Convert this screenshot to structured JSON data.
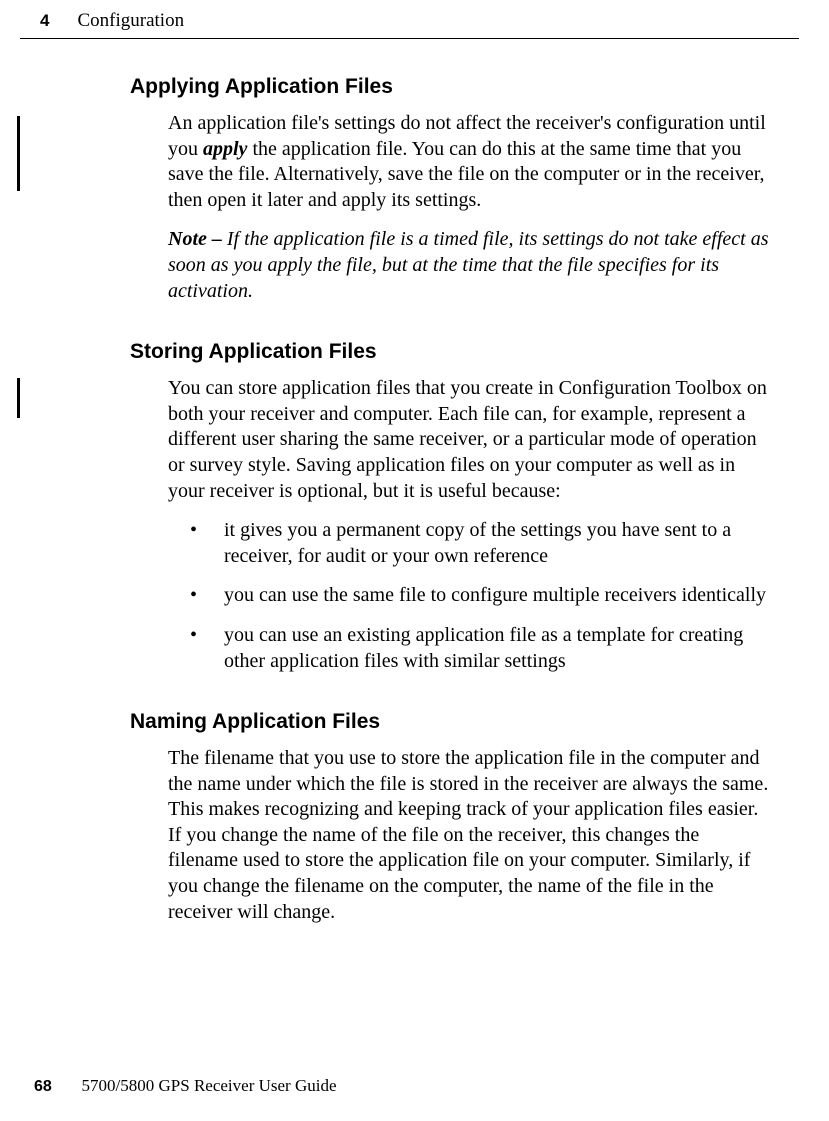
{
  "header": {
    "chapter_number": "4",
    "chapter_title": "Configuration"
  },
  "sections": {
    "applying": {
      "heading": "Applying Application Files",
      "para1_pre": "An application file's settings do not affect the receiver's configuration until you ",
      "para1_em": "apply",
      "para1_post": " the application file. You can do this at the same time that you save the file. Alternatively, save the file on the computer or in the receiver, then open it later and apply its settings.",
      "note_lead": "Note – ",
      "note_body": "If the application file is a timed file, its settings do not take effect as soon as you apply the file, but at the time that the file specifies for its activation."
    },
    "storing": {
      "heading": "Storing Application Files",
      "para1": "You can store application files that you create in Configuration Toolbox on both your receiver and computer. Each file can, for example, represent a different user sharing the same receiver, or a particular mode of operation or survey style. Saving application files on your computer as well as in your receiver is optional, but it is useful because:",
      "bullets": [
        "it gives you a permanent copy of the settings you have sent to a receiver, for audit or your own reference",
        "you can use the same file to configure multiple receivers identically",
        "you can use an existing application file as a template for creating other application files with similar settings"
      ]
    },
    "naming": {
      "heading": "Naming Application Files",
      "para1": "The filename that you use to store the application file in the computer and the name under which the file is stored in the receiver are always the same. This makes recognizing and keeping track of your application files easier. If you change the name of the file on the receiver, this changes the filename used to store the application file on your computer. Similarly, if you change the filename on the computer, the name of the file in the receiver will change."
    }
  },
  "footer": {
    "page_number": "68",
    "guide_title": "5700/5800 GPS Receiver User Guide"
  }
}
